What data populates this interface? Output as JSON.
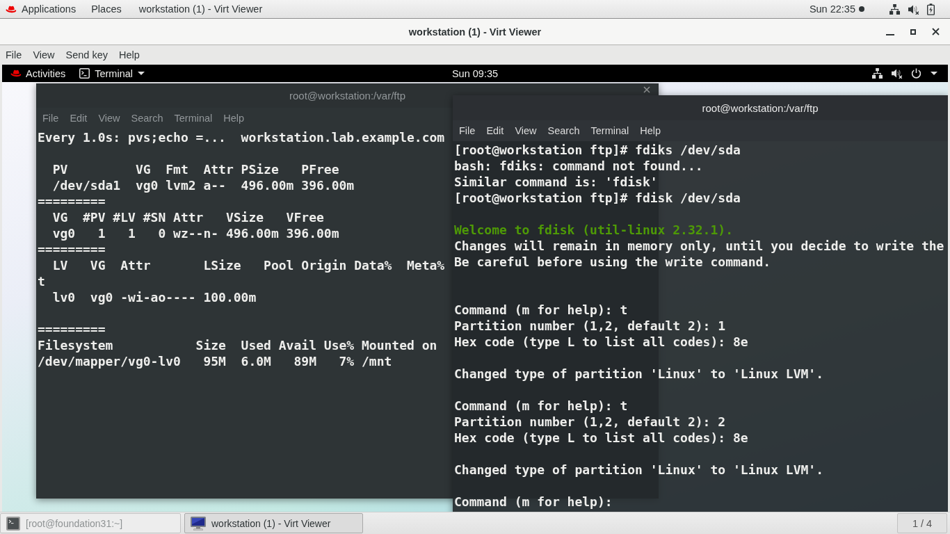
{
  "top_bar": {
    "menus": [
      "Applications",
      "Places"
    ],
    "window_title": "workstation (1) - Virt Viewer",
    "clock": "Sun 22:35"
  },
  "viewer": {
    "title": "workstation (1) - Virt Viewer",
    "menu": [
      "File",
      "View",
      "Send key",
      "Help"
    ]
  },
  "guest_top_bar": {
    "activities": "Activities",
    "app_menu": "Terminal",
    "clock": "Sun 09:35"
  },
  "terminals": [
    {
      "title": "root@workstation:/var/ftp",
      "focused": false,
      "menu": [
        "File",
        "Edit",
        "View",
        "Search",
        "Terminal",
        "Help"
      ],
      "lines": [
        {
          "kind": "text",
          "text": "Every 1.0s: pvs;echo =...  workstation.lab.example.com"
        },
        {
          "kind": "blank"
        },
        {
          "kind": "text",
          "text": "  PV         VG  Fmt  Attr PSize   PFree"
        },
        {
          "kind": "text",
          "text": "  /dev/sda1  vg0 lvm2 a--  496.00m 396.00m"
        },
        {
          "kind": "text",
          "text": "========="
        },
        {
          "kind": "text",
          "text": "  VG  #PV #LV #SN Attr   VSize   VFree"
        },
        {
          "kind": "text",
          "text": "  vg0   1   1   0 wz--n- 496.00m 396.00m"
        },
        {
          "kind": "text",
          "text": "========="
        },
        {
          "kind": "text",
          "text": "  LV   VG  Attr       LSize   Pool Origin Data%  Meta%"
        },
        {
          "kind": "text",
          "text": "t"
        },
        {
          "kind": "text",
          "text": "  lv0  vg0 -wi-ao---- 100.00m"
        },
        {
          "kind": "blank"
        },
        {
          "kind": "text",
          "text": "========="
        },
        {
          "kind": "text",
          "text": "Filesystem           Size  Used Avail Use% Mounted on"
        },
        {
          "kind": "text",
          "text": "/dev/mapper/vg0-lv0   95M  6.0M   89M   7% /mnt"
        }
      ]
    },
    {
      "title": "root@workstation:/var/ftp",
      "focused": true,
      "menu": [
        "File",
        "Edit",
        "View",
        "Search",
        "Terminal",
        "Help"
      ],
      "lines": [
        {
          "kind": "text",
          "text": "[root@workstation ftp]# fdiks /dev/sda"
        },
        {
          "kind": "text",
          "text": "bash: fdiks: command not found..."
        },
        {
          "kind": "text",
          "text": "Similar command is: 'fdisk'"
        },
        {
          "kind": "text",
          "text": "[root@workstation ftp]# fdisk /dev/sda"
        },
        {
          "kind": "blank"
        },
        {
          "kind": "banner",
          "text": "Welcome to fdisk (util-linux 2.32.1)."
        },
        {
          "kind": "text",
          "text": "Changes will remain in memory only, until you decide to write the"
        },
        {
          "kind": "text",
          "text": "Be careful before using the write command."
        },
        {
          "kind": "blank"
        },
        {
          "kind": "blank"
        },
        {
          "kind": "text",
          "text": "Command (m for help): t"
        },
        {
          "kind": "text",
          "text": "Partition number (1,2, default 2): 1"
        },
        {
          "kind": "text",
          "text": "Hex code (type L to list all codes): 8e"
        },
        {
          "kind": "blank"
        },
        {
          "kind": "text",
          "text": "Changed type of partition 'Linux' to 'Linux LVM'."
        },
        {
          "kind": "blank"
        },
        {
          "kind": "text",
          "text": "Command (m for help): t"
        },
        {
          "kind": "text",
          "text": "Partition number (1,2, default 2): 2"
        },
        {
          "kind": "text",
          "text": "Hex code (type L to list all codes): 8e"
        },
        {
          "kind": "blank"
        },
        {
          "kind": "text",
          "text": "Changed type of partition 'Linux' to 'Linux LVM'."
        },
        {
          "kind": "blank"
        },
        {
          "kind": "text",
          "text": "Command (m for help):"
        }
      ]
    }
  ],
  "taskbar": {
    "windows": [
      {
        "label": "[root@foundation31:~]",
        "kind": "terminal",
        "selected": false,
        "minimized": true
      },
      {
        "label": "workstation (1) - Virt Viewer",
        "kind": "viewer",
        "selected": true,
        "minimized": false
      }
    ],
    "workspace": "1 / 4"
  }
}
